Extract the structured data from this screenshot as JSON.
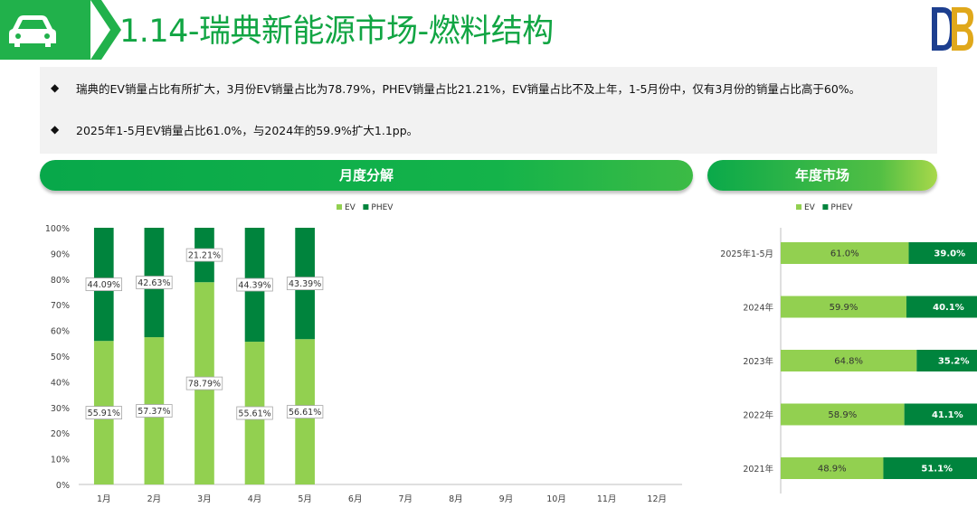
{
  "header": {
    "title": "1.14-瑞典新能源市场-燃料结构"
  },
  "summary": {
    "bullets": [
      {
        "marker": "◆",
        "text": "瑞典的EV销量占比有所扩大，3月份EV销量占比为78.79%，PHEV销量占比21.21%，EV销量占比不及上年，1-5月份中，仅有3月份的销量占比高于60%。"
      },
      {
        "marker": "◆",
        "text": "2025年1-5月EV销量占比61.0%，与2024年的59.9%扩大1.1pp。"
      }
    ]
  },
  "panels": {
    "monthly_title": "月度分解",
    "yearly_title": "年度市场"
  },
  "colors": {
    "ev": "#92d050",
    "phev": "#00843d",
    "accent": "#11a543"
  },
  "icons": {
    "header": "car-icon",
    "logo": "db-logo-icon"
  },
  "chart_data": [
    {
      "type": "bar",
      "stacked": true,
      "orientation": "vertical",
      "categories": [
        "1月",
        "2月",
        "3月",
        "4月",
        "5月",
        "6月",
        "7月",
        "8月",
        "9月",
        "10月",
        "11月",
        "12月"
      ],
      "series": [
        {
          "name": "EV",
          "color": "#92d050",
          "values": [
            55.91,
            57.37,
            78.79,
            55.61,
            56.61,
            null,
            null,
            null,
            null,
            null,
            null,
            null
          ],
          "labels": [
            "55.91%",
            "57.37%",
            "78.79%",
            "55.61%",
            "56.61%"
          ]
        },
        {
          "name": "PHEV",
          "color": "#00843d",
          "values": [
            44.09,
            42.63,
            21.21,
            44.39,
            43.39,
            null,
            null,
            null,
            null,
            null,
            null,
            null
          ],
          "labels": [
            "44.09%",
            "42.63%",
            "21.21%",
            "44.39%",
            "43.39%"
          ]
        }
      ],
      "yticks": [
        "0%",
        "10%",
        "20%",
        "30%",
        "40%",
        "50%",
        "60%",
        "70%",
        "80%",
        "90%",
        "100%"
      ],
      "ylim": [
        0,
        100
      ],
      "legend": [
        "EV",
        "PHEV"
      ],
      "legend_position": "top"
    },
    {
      "type": "bar",
      "stacked": true,
      "orientation": "horizontal",
      "categories": [
        "2025年1-5月",
        "2024年",
        "2023年",
        "2022年",
        "2021年"
      ],
      "series": [
        {
          "name": "EV",
          "color": "#92d050",
          "values": [
            61.0,
            59.9,
            64.8,
            58.9,
            48.9
          ],
          "labels": [
            "61.0%",
            "59.9%",
            "64.8%",
            "58.9%",
            "48.9%"
          ]
        },
        {
          "name": "PHEV",
          "color": "#00843d",
          "values": [
            39.0,
            40.1,
            35.2,
            41.1,
            51.1
          ],
          "labels": [
            "39.0%",
            "40.1%",
            "35.2%",
            "41.1%",
            "51.1%"
          ]
        }
      ],
      "xlim": [
        0,
        100
      ],
      "legend": [
        "EV",
        "PHEV"
      ],
      "legend_position": "top"
    }
  ]
}
